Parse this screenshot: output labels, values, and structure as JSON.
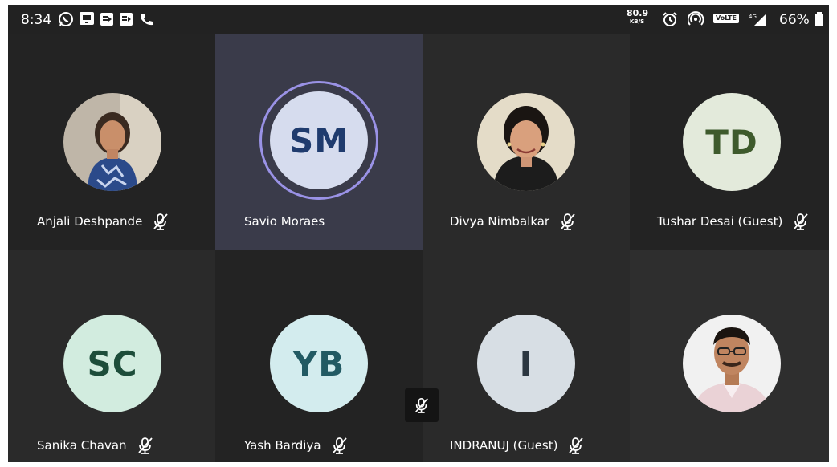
{
  "status_bar": {
    "time": "8:34",
    "left_icons": [
      "whatsapp-icon",
      "messenger-icon",
      "media-icon",
      "media-icon",
      "phone-icon"
    ],
    "net_speed_value": "80.9",
    "net_speed_unit": "KB/S",
    "volte": "VoLTE",
    "network": "4G",
    "battery_percent": "66%"
  },
  "participants": [
    {
      "name": "Anjali Deshpande",
      "initials": "",
      "avatar_type": "photo",
      "muted": true
    },
    {
      "name": "Savio Moraes",
      "initials": "SM",
      "avatar_type": "initials",
      "muted": false,
      "speaking": true
    },
    {
      "name": "Divya Nimbalkar",
      "initials": "",
      "avatar_type": "photo",
      "muted": true
    },
    {
      "name": "Tushar Desai (Guest)",
      "initials": "TD",
      "avatar_type": "initials",
      "muted": true
    },
    {
      "name": "Sanika Chavan",
      "initials": "SC",
      "avatar_type": "initials",
      "muted": true
    },
    {
      "name": "Yash Bardiya",
      "initials": "YB",
      "avatar_type": "initials",
      "muted": true
    },
    {
      "name": "INDRANUJ (Guest)",
      "initials": "I",
      "avatar_type": "initials",
      "muted": true
    },
    {
      "name": "",
      "initials": "",
      "avatar_type": "photo",
      "muted": false
    }
  ],
  "colors": {
    "active_tile": "#3a3b4a",
    "speaking_ring": "#9a92e6",
    "sm_avatar_bg": "#d6dcee",
    "sm_avatar_text": "#1f3b6e",
    "td_avatar_bg": "#e3eadb",
    "td_avatar_text": "#3e5a2c",
    "sc_avatar_bg": "#d2ecdf",
    "sc_avatar_text": "#1d4d3a",
    "yb_avatar_bg": "#d3ecee",
    "yb_avatar_text": "#225a63",
    "i_avatar_bg": "#d7dee4",
    "i_avatar_text": "#2b3640"
  },
  "floating_button": {
    "icon": "mic-off-icon"
  }
}
